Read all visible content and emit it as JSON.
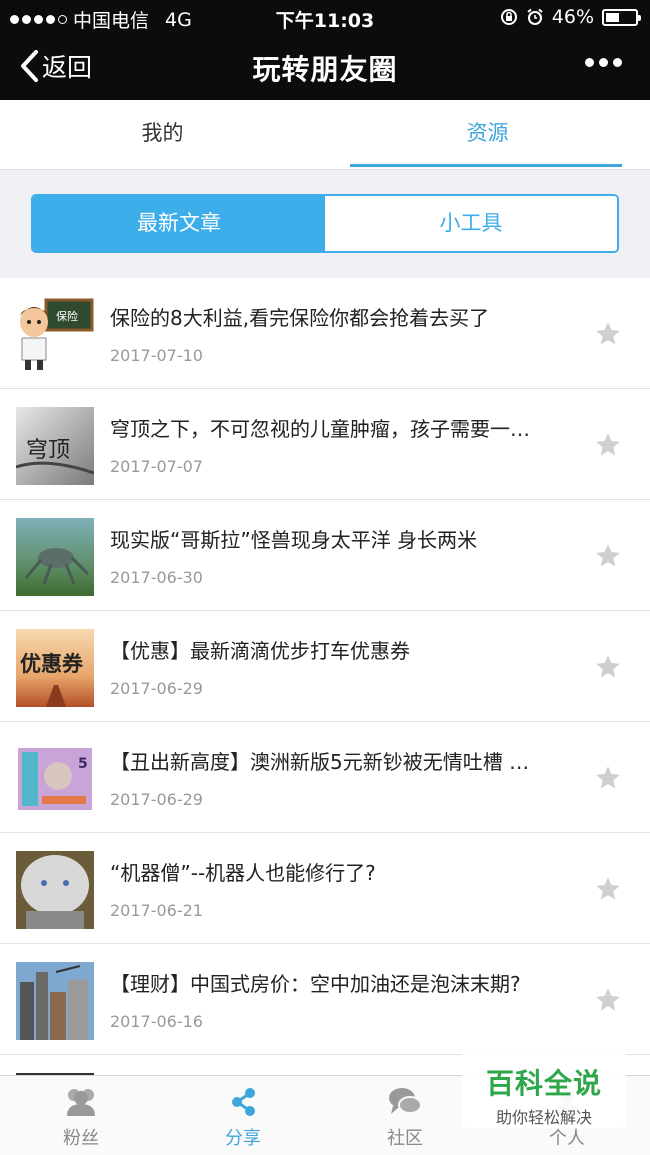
{
  "status": {
    "carrier": "中国电信",
    "network": "4G",
    "time": "下午11:03",
    "battery": "46%",
    "battery_level": 0.46
  },
  "nav": {
    "back_label": "返回",
    "title": "玩转朋友圈"
  },
  "tabs": [
    {
      "label": "我的"
    },
    {
      "label": "资源"
    }
  ],
  "segment": {
    "items": [
      {
        "label": "最新文章"
      },
      {
        "label": "小工具"
      }
    ]
  },
  "articles": [
    {
      "title": "保险的8大利益,看完保险你都会抢着去买了",
      "date": "2017-07-10"
    },
    {
      "title": "穹顶之下，不可忽视的儿童肿瘤，孩子需要一…",
      "date": "2017-07-07"
    },
    {
      "title": "现实版“哥斯拉”怪兽现身太平洋 身长两米",
      "date": "2017-06-30"
    },
    {
      "title": "【优惠】最新滴滴优步打车优惠券",
      "date": "2017-06-29"
    },
    {
      "title": "【丑出新高度】澳洲新版5元新钞被无情吐槽 …",
      "date": "2017-06-29"
    },
    {
      "title": "“机器僧”--机器人也能修行了?",
      "date": "2017-06-21"
    },
    {
      "title": "【理财】中国式房价：空中加油还是泡沫末期?",
      "date": "2017-06-16"
    }
  ],
  "thumb_text": {
    "insurance": "保险",
    "dome": "穹顶",
    "coupon": "优惠券",
    "note": "5"
  },
  "bottom_tabs": [
    {
      "label": "粉丝"
    },
    {
      "label": "分享"
    },
    {
      "label": "社区"
    },
    {
      "label": "个人"
    }
  ],
  "watermark": {
    "brand": "百科全说",
    "slogan": "助你轻松解决"
  },
  "colors": {
    "accent": "#3ea6db",
    "nav_bg": "#0c0c0c",
    "watermark_green": "#2ea64a"
  }
}
